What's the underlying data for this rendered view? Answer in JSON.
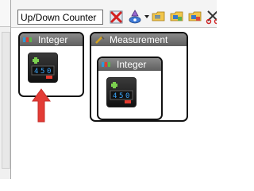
{
  "search": {
    "value": "Up/Down Counter"
  },
  "toolbar": {
    "icons": [
      "delete-icon",
      "options-icon",
      "folder-open-icon",
      "folder-add-icon",
      "folder-remove-icon",
      "cut-icon"
    ]
  },
  "cards": {
    "integer": {
      "title": "Integer"
    },
    "measurement": {
      "title": "Measurement",
      "child": {
        "title": "Integer"
      }
    }
  },
  "colors": {
    "card_header": "#6e6e6e",
    "arrow": "#e33b35",
    "tile_bg": "#1a1a1a"
  }
}
